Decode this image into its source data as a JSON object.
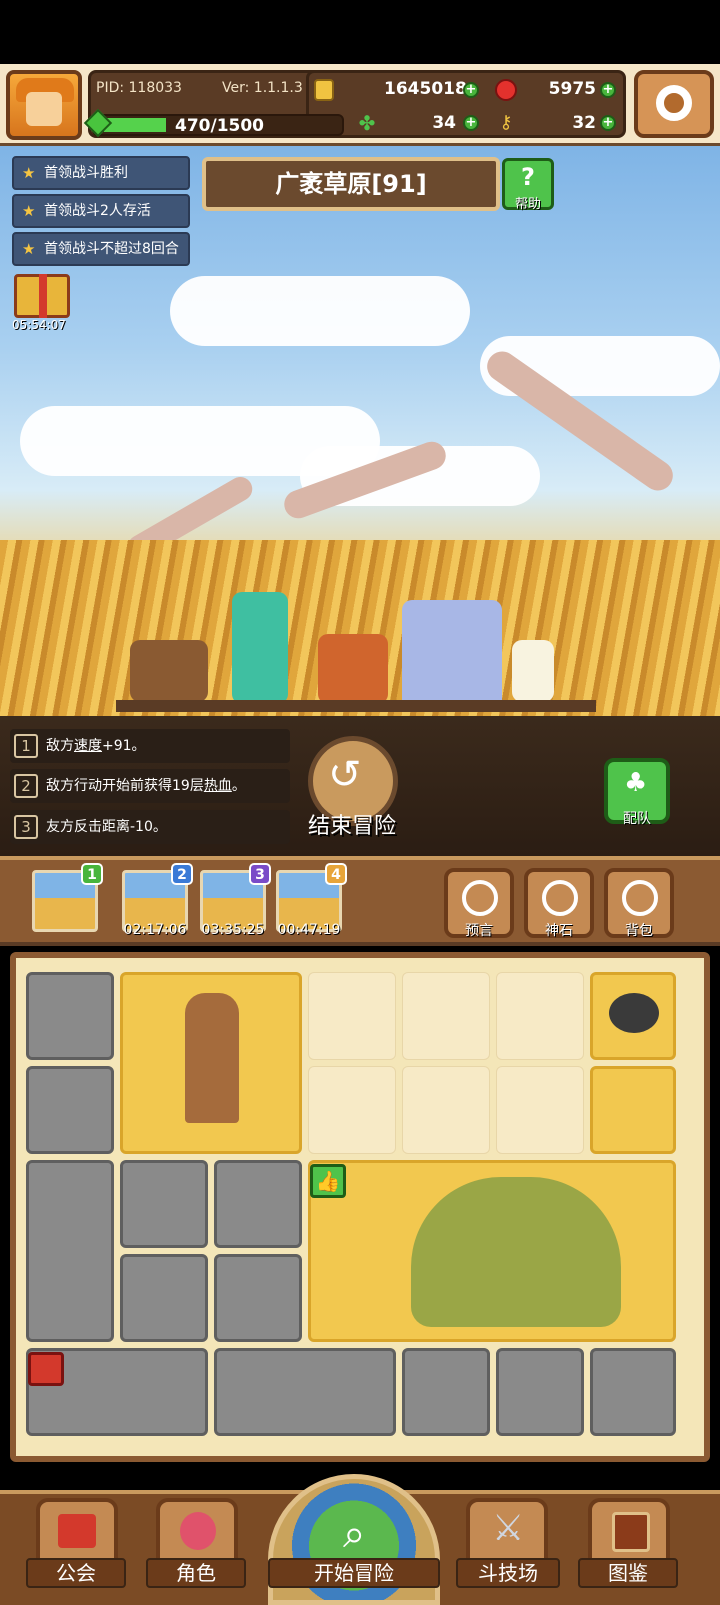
{
  "header": {
    "pid": "PID: 118033",
    "version": "Ver: 1.1.1.3",
    "gold": "1645018",
    "ruby": "5975",
    "clover": "34",
    "key": "32",
    "xp": "470/1500"
  },
  "quests": [
    "首领战斗胜利",
    "首领战斗2人存活",
    "首领战斗不超过8回合"
  ],
  "gift_timer": "05:54:07",
  "area_title": "广袤草原[91]",
  "help_label": "帮助",
  "effects": [
    {
      "num": "1",
      "pre": "敌方",
      "u": "速度",
      "post": "+91。"
    },
    {
      "num": "2",
      "pre": "敌方行动开始前获得19层",
      "u": "热血",
      "post": "。"
    },
    {
      "num": "3",
      "pre": "友方反击距离-10。",
      "u": "",
      "post": ""
    }
  ],
  "end_label": "结束冒险",
  "team_label": "配队",
  "stages": [
    {
      "badge": "1",
      "color": "#48b53c",
      "timer": ""
    },
    {
      "badge": "2",
      "color": "#3a7ad6",
      "timer": "02:17:06"
    },
    {
      "badge": "3",
      "color": "#7a4bc8",
      "timer": "03:35:25"
    },
    {
      "badge": "4",
      "color": "#e8a53a",
      "timer": "00:47:19"
    }
  ],
  "tools": [
    "预言",
    "神石",
    "背包"
  ],
  "nav": {
    "guild": "公会",
    "role": "角色",
    "start": "开始冒险",
    "arena": "斗技场",
    "atlas": "图鉴"
  }
}
